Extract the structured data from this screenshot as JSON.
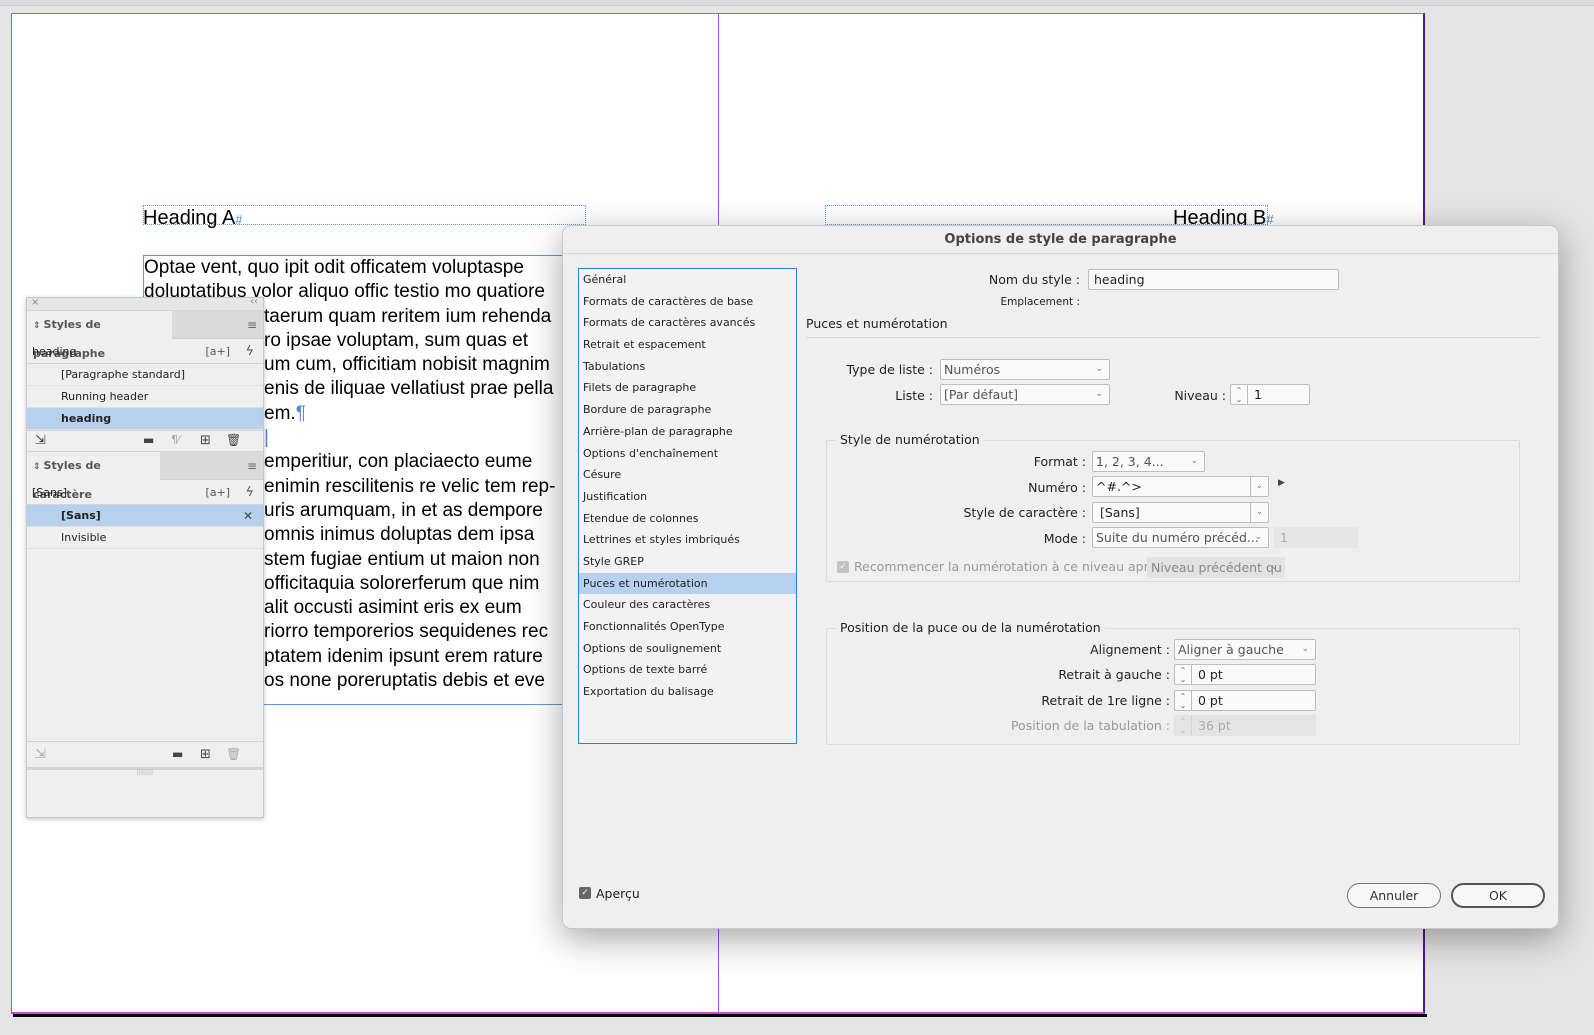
{
  "document": {
    "left_page": {
      "heading": "Heading A",
      "body_paragraphs": [
        [
          "Optae vent, quo ipit odit officatem voluptaspe",
          "doluptatibus volor aliquo offic testio mo quatiore",
          "xxxx taerum quam reritem ium rehenda",
          "xxxxro ipsae voluptam, sum quas et",
          "xxxxum cum, officitiam nobisit magnim",
          "xxxxenis de iliquae vellatiust prae pella",
          "xxxxem."
        ],
        [
          ""
        ],
        [
          "xxxxt emperitiur, con placiaecto eume",
          "xxxxenimin rescilitenis re velic tem rep-",
          "xxxxuris arumquam, in et as dempore",
          "xxxxomnis inimus doluptas dem ipsa",
          "xxxxstem fugiae entium ut maion non",
          "xxxx officitaquia solorerferum que nim",
          "xxxxalit occusti asimint eris ex eum",
          "xxxxriorro temporerios sequidenes rec",
          "xxxxptatem idenim ipsunt erem rature",
          "xxxxos none poreruptatis debis et eve"
        ]
      ],
      "visible_lines": [
        "Optae vent, quo ipit odit officatem voluptaspe",
        "doluptatibus volor aliquo offic testio mo quatiore",
        "taerum quam reritem ium rehenda",
        "ro ipsae voluptam, sum quas et",
        "um cum, officitiam nobisit magnim",
        "enis de iliquae vellatiust prae pella",
        "em.",
        "",
        "",
        "emperitiur, con placiaecto eume",
        "enimin rescilitenis re velic tem rep-",
        "uris arumquam, in et as dempore",
        "omnis inimus doluptas dem ipsa",
        "stem fugiae entium ut maion non",
        "officitaquia solorerferum que nim",
        "alit occusti asimint eris ex eum",
        "riorro temporerios sequidenes rec",
        "ptatem idenim ipsunt erem rature",
        "os none poreruptatis debis et eve"
      ]
    },
    "right_page": {
      "heading": "Heading B"
    },
    "hidden_char_symbols": {
      "end_of_story": "#",
      "pilcrow": "¶"
    }
  },
  "panel": {
    "close_icon": "×",
    "collapse_icon": "‹‹",
    "paragraph_styles": {
      "tab_label": "Styles de paragraphe",
      "current_style": "heading",
      "new_style_icon": "[a+]",
      "quick_apply_icon": "ϟ",
      "items": [
        {
          "label": "[Paragraphe standard]",
          "selected": false
        },
        {
          "label": "Running header",
          "selected": false
        },
        {
          "label": "heading",
          "selected": true
        }
      ]
    },
    "character_styles": {
      "tab_label": "Styles de caractère",
      "current_style": "[Sans]",
      "new_style_icon": "[a+]",
      "quick_apply_icon": "ϟ",
      "items": [
        {
          "label": "[Sans]",
          "selected": true
        },
        {
          "label": "Invisible",
          "selected": false
        }
      ]
    },
    "footer_icons": {
      "load_styles": "⇲",
      "folder": "▬",
      "clear_overrides": "¶⁄",
      "new_style": "⊞",
      "delete": "🗑"
    }
  },
  "dialog": {
    "title": "Options de style de paragraphe",
    "categories": [
      {
        "label": "Général",
        "selected": false
      },
      {
        "label": "Formats de caractères de base",
        "selected": false
      },
      {
        "label": "Formats de caractères avancés",
        "selected": false
      },
      {
        "label": "Retrait et espacement",
        "selected": false
      },
      {
        "label": "Tabulations",
        "selected": false
      },
      {
        "label": "Filets de paragraphe",
        "selected": false
      },
      {
        "label": "Bordure de paragraphe",
        "selected": false
      },
      {
        "label": "Arrière-plan de paragraphe",
        "selected": false
      },
      {
        "label": "Options d'enchaînement",
        "selected": false
      },
      {
        "label": "Césure",
        "selected": false
      },
      {
        "label": "Justification",
        "selected": false
      },
      {
        "label": "Etendue de colonnes",
        "selected": false
      },
      {
        "label": "Lettrines et styles imbriqués",
        "selected": false
      },
      {
        "label": "Style GREP",
        "selected": false
      },
      {
        "label": "Puces et numérotation",
        "selected": true
      },
      {
        "label": "Couleur des caractères",
        "selected": false
      },
      {
        "label": "Fonctionnalités OpenType",
        "selected": false
      },
      {
        "label": "Options de soulignement",
        "selected": false
      },
      {
        "label": "Options de texte barré",
        "selected": false
      },
      {
        "label": "Exportation du balisage",
        "selected": false
      }
    ],
    "style_name_label": "Nom du style :",
    "style_name_value": "heading",
    "location_label": "Emplacement :",
    "location_value": "",
    "section_title": "Puces et numérotation",
    "list_type_label": "Type de liste :",
    "list_type_value": "Numéros",
    "list_label": "Liste :",
    "list_value": "[Par défaut]",
    "level_label": "Niveau :",
    "level_value": "1",
    "numbering_style": {
      "title": "Style de numérotation",
      "format_label": "Format :",
      "format_value": "1, 2, 3, 4...",
      "number_label": "Numéro :",
      "number_value": "^#.^>",
      "char_style_label": "Style de caractère :",
      "char_style_value": "[Sans]",
      "mode_label": "Mode :",
      "mode_value": "Suite du numéro précéd...",
      "mode_start_value": "1",
      "restart_label": "Recommencer la numérotation à ce niveau après :",
      "restart_checked": true,
      "restart_value": "Niveau précédent qu"
    },
    "position": {
      "title": "Position de la puce ou de la numérotation",
      "alignment_label": "Alignement :",
      "alignment_value": "Aligner à gauche",
      "left_indent_label": "Retrait à gauche :",
      "left_indent_value": "0 pt",
      "first_line_label": "Retrait de 1re ligne :",
      "first_line_value": "0 pt",
      "tab_position_label": "Position de la tabulation :",
      "tab_position_value": "36 pt"
    },
    "preview_label": "Aperçu",
    "preview_checked": true,
    "cancel_label": "Annuler",
    "ok_label": "OK"
  }
}
